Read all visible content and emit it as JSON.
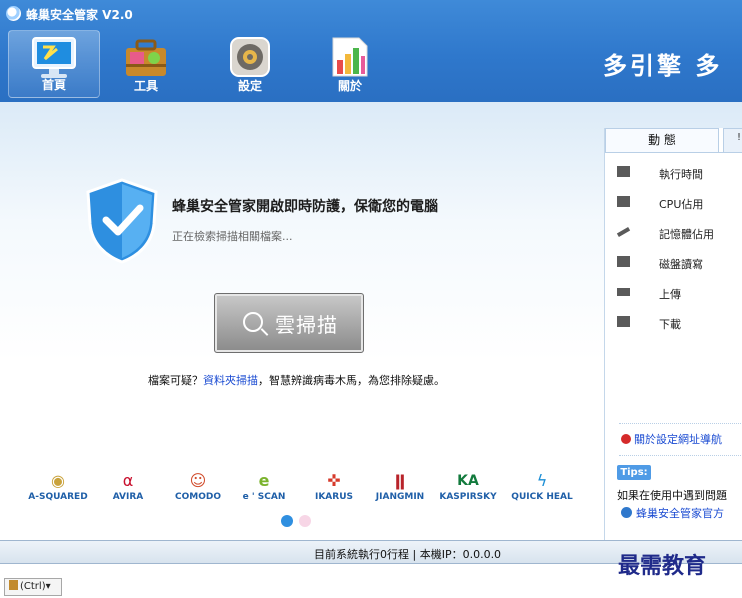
{
  "app": {
    "title": "蜂巢安全管家 V2.0",
    "logo_icon": "app-logo-icon"
  },
  "nav": {
    "tabs": [
      {
        "label": "首頁",
        "icon": "monitor-home-icon",
        "active": true
      },
      {
        "label": "工具",
        "icon": "toolbox-icon",
        "active": false
      },
      {
        "label": "設定",
        "icon": "gear-settings-icon",
        "active": false
      },
      {
        "label": "關於",
        "icon": "about-chart-icon",
        "active": false
      }
    ],
    "slogan": "多引擎 多"
  },
  "protection": {
    "title": "蜂巢安全管家開啟即時防護，保衛您的電腦",
    "status": "正在檢索掃描相關檔案..."
  },
  "scan_button": {
    "label": "雲掃描"
  },
  "hint": {
    "prefix": "檔案可疑？",
    "link": "資料夾掃描",
    "suffix": "，智慧辨識病毒木馬，為您排除疑慮。"
  },
  "engines": [
    {
      "name": "A-SQUARED",
      "color": "#c9a23b",
      "glyph": "◉"
    },
    {
      "name": "AVIRA",
      "color": "#c8102e",
      "glyph": "α"
    },
    {
      "name": "COMODO",
      "color": "#d14b2b",
      "glyph": "☺"
    },
    {
      "name": "e ' SCAN",
      "color": "#7bb32e",
      "glyph": "e"
    },
    {
      "name": "IKARUS",
      "color": "#d63a2b",
      "glyph": "✜"
    },
    {
      "name": "JIANGMIN",
      "color": "#b8232a",
      "glyph": "ǁ"
    },
    {
      "name": "KASPIRSKY",
      "color": "#127a3d",
      "glyph": "KA"
    },
    {
      "name": "QUICK HEAL",
      "color": "#1e8fd6",
      "glyph": "ϟ"
    }
  ],
  "pager": {
    "active_color": "#2f8fe0",
    "inactive_color": "#f7d6e6"
  },
  "panel": {
    "tab_label": "動 態",
    "corner_text": "!",
    "stats": [
      {
        "label": "執行時間",
        "icon": "clock-icon"
      },
      {
        "label": "CPU佔用",
        "icon": "cpu-icon"
      },
      {
        "label": "記憶體佔用",
        "icon": "memory-icon"
      },
      {
        "label": "磁盤讀寫",
        "icon": "disk-icon"
      },
      {
        "label": "上傳",
        "icon": "upload-icon"
      },
      {
        "label": "下載",
        "icon": "download-icon"
      }
    ],
    "link": "關於設定網址導航",
    "tips_badge": "Tips:",
    "tips_text": "如果在使用中遇到問題",
    "tips_link": "蜂巢安全管家官方"
  },
  "statusbar": {
    "text": "目前系統執行0行程 | 本機IP：0.0.0.0"
  },
  "watermark": "最需教育",
  "ctrl_chip": {
    "label": "(Ctrl)▾"
  }
}
